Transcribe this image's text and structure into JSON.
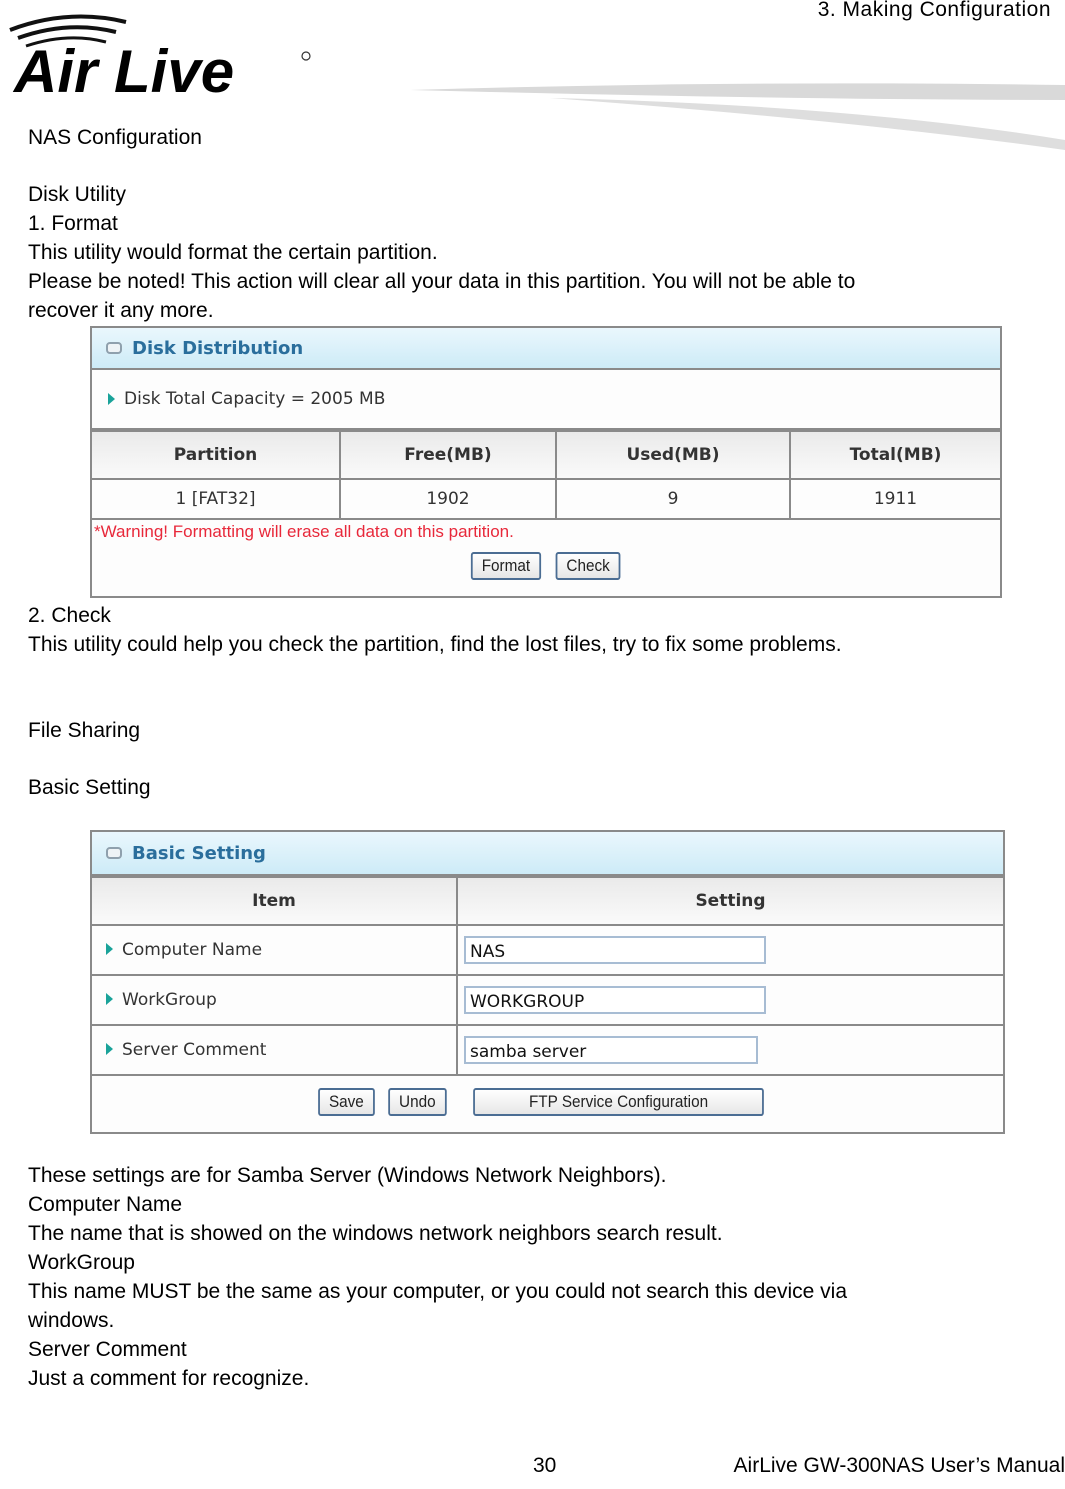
{
  "header": {
    "brand": "Air Live",
    "chapter": "3.  Making  Configuration"
  },
  "body_top": [
    "NAS Configuration",
    "Disk Utility",
    "1. Format",
    "This utility would format the certain partition.",
    "Please be noted! This action will clear all your data in this partition. You will not be able to",
    "recover it any more."
  ],
  "disk_panel": {
    "title": "Disk Distribution",
    "capacity_label": "Disk Total Capacity = 2005 MB",
    "columns": [
      "Partition",
      "Free(MB)",
      "Used(MB)",
      "Total(MB)"
    ],
    "rows": [
      [
        "1 [FAT32]",
        "1902",
        "9",
        "1911"
      ]
    ],
    "warning": "*Warning! Formatting will erase all data on this partition.",
    "buttons": {
      "format": "Format",
      "check": "Check"
    }
  },
  "body_mid": [
    "2. Check",
    "This utility could help you check the partition, find the lost files, try to fix some problems.",
    "File Sharing",
    "Basic Setting"
  ],
  "basic_panel": {
    "title": "Basic Setting",
    "columns": [
      "Item",
      "Setting"
    ],
    "rows": [
      {
        "label": "Computer Name",
        "value": "NAS"
      },
      {
        "label": "WorkGroup",
        "value": "WORKGROUP"
      },
      {
        "label": "Server Comment",
        "value": "samba server"
      }
    ],
    "buttons": {
      "save": "Save",
      "undo": "Undo",
      "ftp": "FTP Service Configuration"
    }
  },
  "body_bottom": [
    "These settings are for Samba Server (Windows Network Neighbors).",
    "Computer Name",
    "The name that is showed on the windows network neighbors search result.",
    "WorkGroup",
    "This name MUST be the same as your computer, or you could not search this device via",
    "windows.",
    "Server Comment",
    "Just a comment for recognize."
  ],
  "footer": {
    "page_number": "30",
    "manual_title": "AirLive GW-300NAS User’s Manual"
  }
}
